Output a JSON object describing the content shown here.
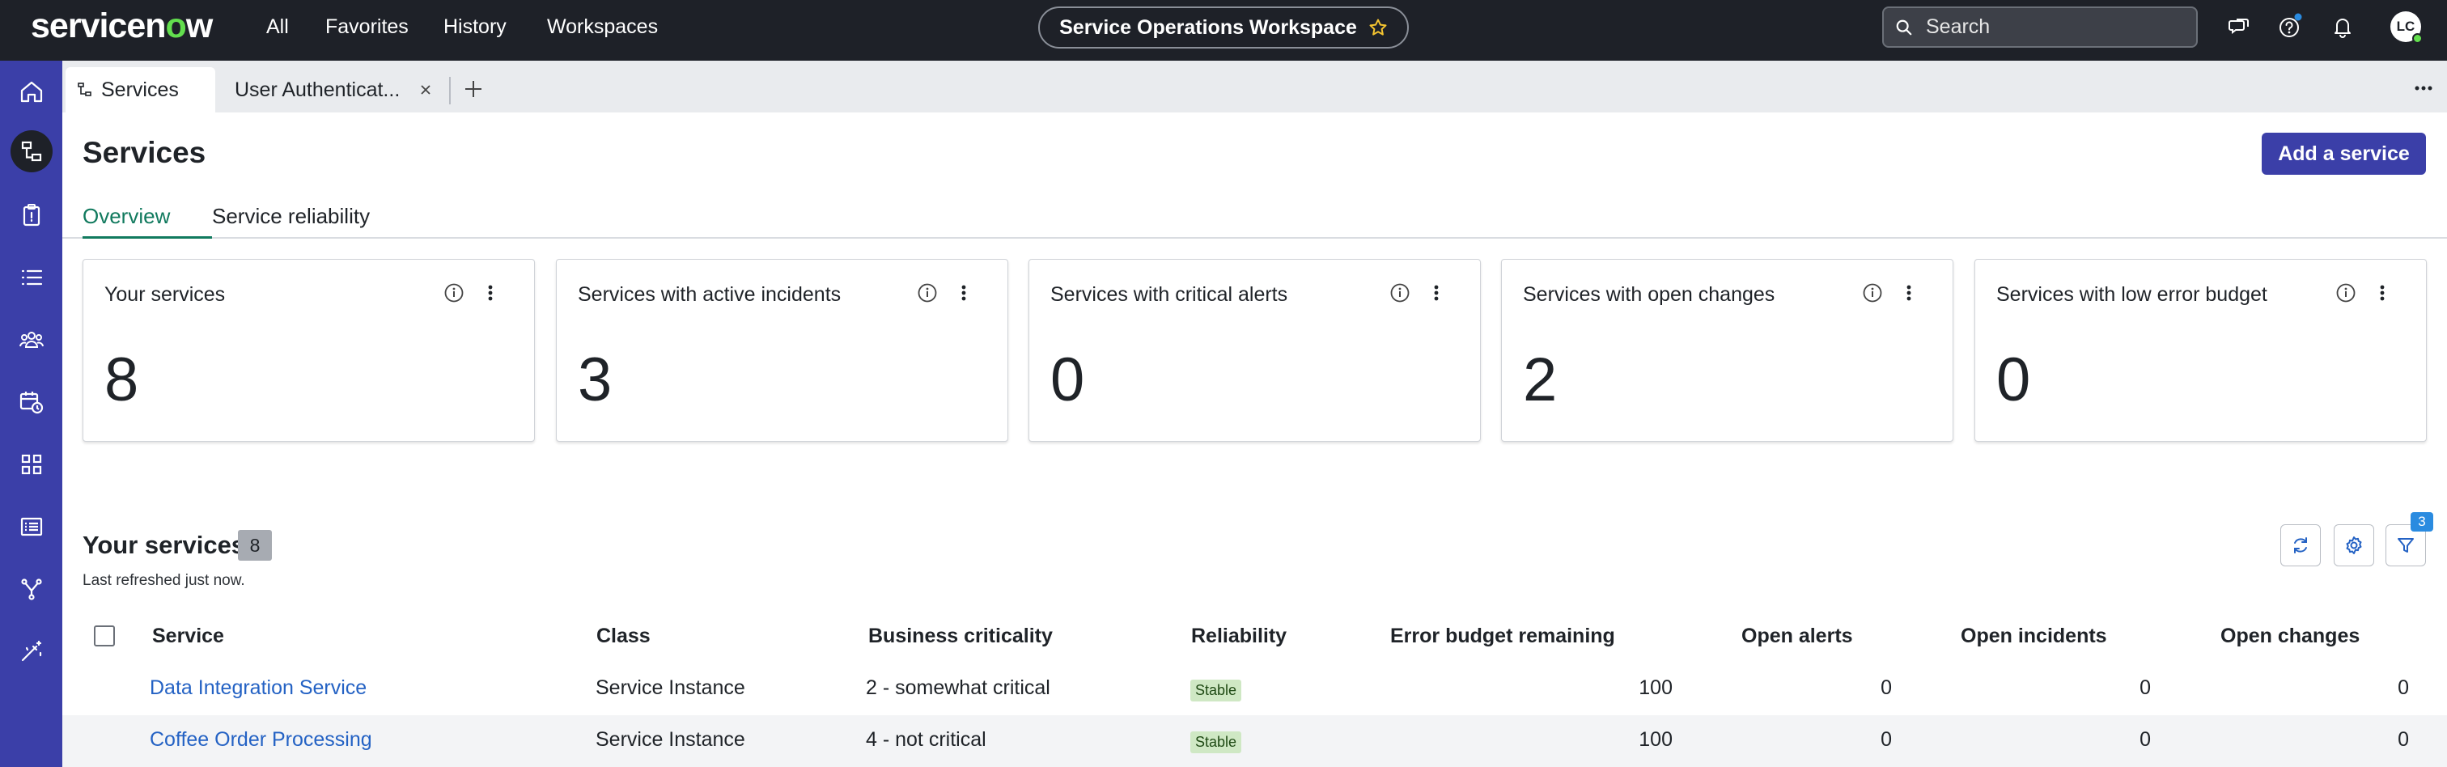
{
  "topbar": {
    "logo_main": "servicen",
    "logo_o": "o",
    "logo_end": "w",
    "nav": [
      "All",
      "Favorites",
      "History",
      "Workspaces"
    ],
    "workspace_name": "Service Operations Workspace",
    "search_placeholder": "Search",
    "avatar_initials": "LC"
  },
  "sidebar": {
    "icons": [
      "home-icon",
      "services-icon",
      "clipboard-icon",
      "list-icon",
      "team-icon",
      "calendar-clock-icon",
      "grid-icon",
      "list-alt-icon",
      "branch-icon",
      "wand-icon"
    ]
  },
  "tabs": [
    {
      "label": "Services"
    },
    {
      "label": "User Authenticat..."
    }
  ],
  "page": {
    "title": "Services",
    "add_button": "Add a service",
    "subtabs": [
      "Overview",
      "Service reliability"
    ]
  },
  "cards": [
    {
      "title": "Your services",
      "value": "8"
    },
    {
      "title": "Services with active incidents",
      "value": "3"
    },
    {
      "title": "Services with critical alerts",
      "value": "0"
    },
    {
      "title": "Services with open changes",
      "value": "2"
    },
    {
      "title": "Services with low error budget",
      "value": "0"
    }
  ],
  "list": {
    "title": "Your services",
    "count": "8",
    "refreshed": "Last refreshed just now.",
    "filter_badge": "3",
    "columns": [
      "Service",
      "Class",
      "Business criticality",
      "Reliability",
      "Error budget remaining",
      "Open alerts",
      "Open incidents",
      "Open changes"
    ],
    "rows": [
      {
        "service": "Data Integration Service",
        "class": "Service Instance",
        "criticality": "2 - somewhat critical",
        "reliability": "Stable",
        "error_budget": "100",
        "alerts": "0",
        "incidents": "0",
        "changes": "0"
      },
      {
        "service": "Coffee Order Processing",
        "class": "Service Instance",
        "criticality": "4 - not critical",
        "reliability": "Stable",
        "error_budget": "100",
        "alerts": "0",
        "incidents": "0",
        "changes": "0"
      }
    ]
  },
  "colors": {
    "topbar": "#1e2128",
    "sidebar": "#3b3fa8",
    "accent": "#3b3fa8",
    "active_tab": "#117a5e",
    "link": "#2462c4",
    "stable_pill": "#cfe8c4"
  }
}
